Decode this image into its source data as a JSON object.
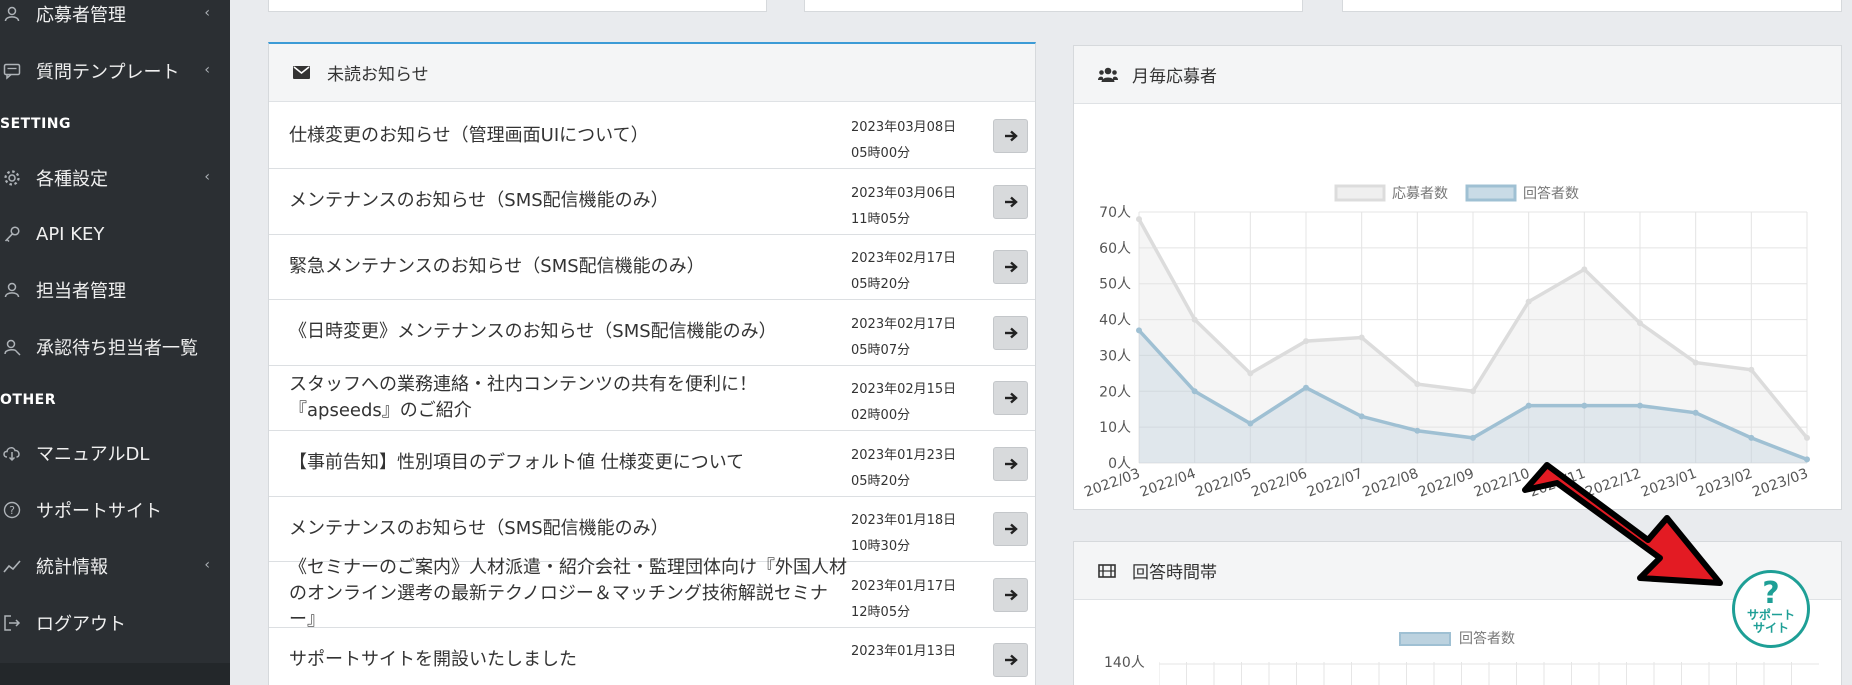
{
  "sidebar": {
    "items": [
      {
        "label": "応募者管理",
        "icon": "user-icon",
        "chevron": "‹"
      },
      {
        "label": "質問テンプレート",
        "icon": "comment-icon",
        "chevron": "‹"
      },
      {
        "label": "各種設定",
        "icon": "gear-icon",
        "chevron": "‹"
      },
      {
        "label": "API KEY",
        "icon": "key-icon",
        "chevron": ""
      },
      {
        "label": "担当者管理",
        "icon": "user-icon",
        "chevron": ""
      },
      {
        "label": "承認待ち担当者一覧",
        "icon": "user-search-icon",
        "chevron": ""
      },
      {
        "label": "マニュアルDL",
        "icon": "cloud-download-icon",
        "chevron": ""
      },
      {
        "label": "サポートサイト",
        "icon": "question-circle-icon",
        "chevron": ""
      },
      {
        "label": "統計情報",
        "icon": "line-chart-icon",
        "chevron": "‹"
      },
      {
        "label": "ログアウト",
        "icon": "logout-icon",
        "chevron": ""
      }
    ],
    "sections": [
      "SETTING",
      "OTHER"
    ]
  },
  "notices": {
    "title": "未読お知らせ",
    "icon": "envelope-icon",
    "rows": [
      {
        "title": "仕様変更のお知らせ（管理画面UIについて）",
        "date": "2023年03月08日",
        "time": "05時00分"
      },
      {
        "title": "メンテナンスのお知らせ（SMS配信機能のみ）",
        "date": "2023年03月06日",
        "time": "11時05分"
      },
      {
        "title": "緊急メンテナンスのお知らせ（SMS配信機能のみ）",
        "date": "2023年02月17日",
        "time": "05時20分"
      },
      {
        "title": "《日時変更》メンテナンスのお知らせ（SMS配信機能のみ）",
        "date": "2023年02月17日",
        "time": "05時07分"
      },
      {
        "title": "スタッフへの業務連絡・社内コンテンツの共有を便利に！『apseeds』のご紹介",
        "date": "2023年02月15日",
        "time": "02時00分"
      },
      {
        "title": "【事前告知】性別項目のデフォルト値 仕様変更について",
        "date": "2023年01月23日",
        "time": "05時20分"
      },
      {
        "title": "メンテナンスのお知らせ（SMS配信機能のみ）",
        "date": "2023年01月18日",
        "time": "10時30分"
      },
      {
        "title": "《セミナーのご案内》人材派遣・紹介会社・監理団体向け『外国人材のオンライン選考の最新テクノロジー＆マッチング技術解説セミナー』",
        "date": "2023年01月17日",
        "time": "12時05分"
      },
      {
        "title": "サポートサイトを開設いたしました",
        "date": "2023年01月13日",
        "time": ""
      }
    ]
  },
  "monthly_panel": {
    "title": "月毎応募者",
    "icon": "users-icon"
  },
  "time_panel": {
    "title": "回答時間帯",
    "icon": "film-icon",
    "legend": "回答者数",
    "top_tick": "140人"
  },
  "support_badge": {
    "q": "?",
    "line1": "サポート",
    "line2": "サイト"
  },
  "colors": {
    "applicants": "#dcdcdc",
    "respondents": "#9fc0d3",
    "accent": "#3c9bd6",
    "support": "#1e9f96",
    "arrow": "#e31b23"
  },
  "chart_data": {
    "type": "line",
    "categories": [
      "2022/03",
      "2022/04",
      "2022/05",
      "2022/06",
      "2022/07",
      "2022/08",
      "2022/09",
      "2022/10",
      "2022/11",
      "2022/12",
      "2023/01",
      "2023/02",
      "2023/03"
    ],
    "series": [
      {
        "name": "応募者数",
        "values": [
          68,
          40,
          25,
          34,
          35,
          22,
          20,
          45,
          54,
          39,
          28,
          26,
          7
        ]
      },
      {
        "name": "回答者数",
        "values": [
          37,
          20,
          11,
          21,
          13,
          9,
          7,
          16,
          16,
          16,
          14,
          7,
          1
        ]
      }
    ],
    "yticks": [
      "0人",
      "10人",
      "20人",
      "30人",
      "40人",
      "50人",
      "60人",
      "70人"
    ],
    "ylim": [
      0,
      70
    ],
    "grid": true,
    "legend": "top"
  }
}
